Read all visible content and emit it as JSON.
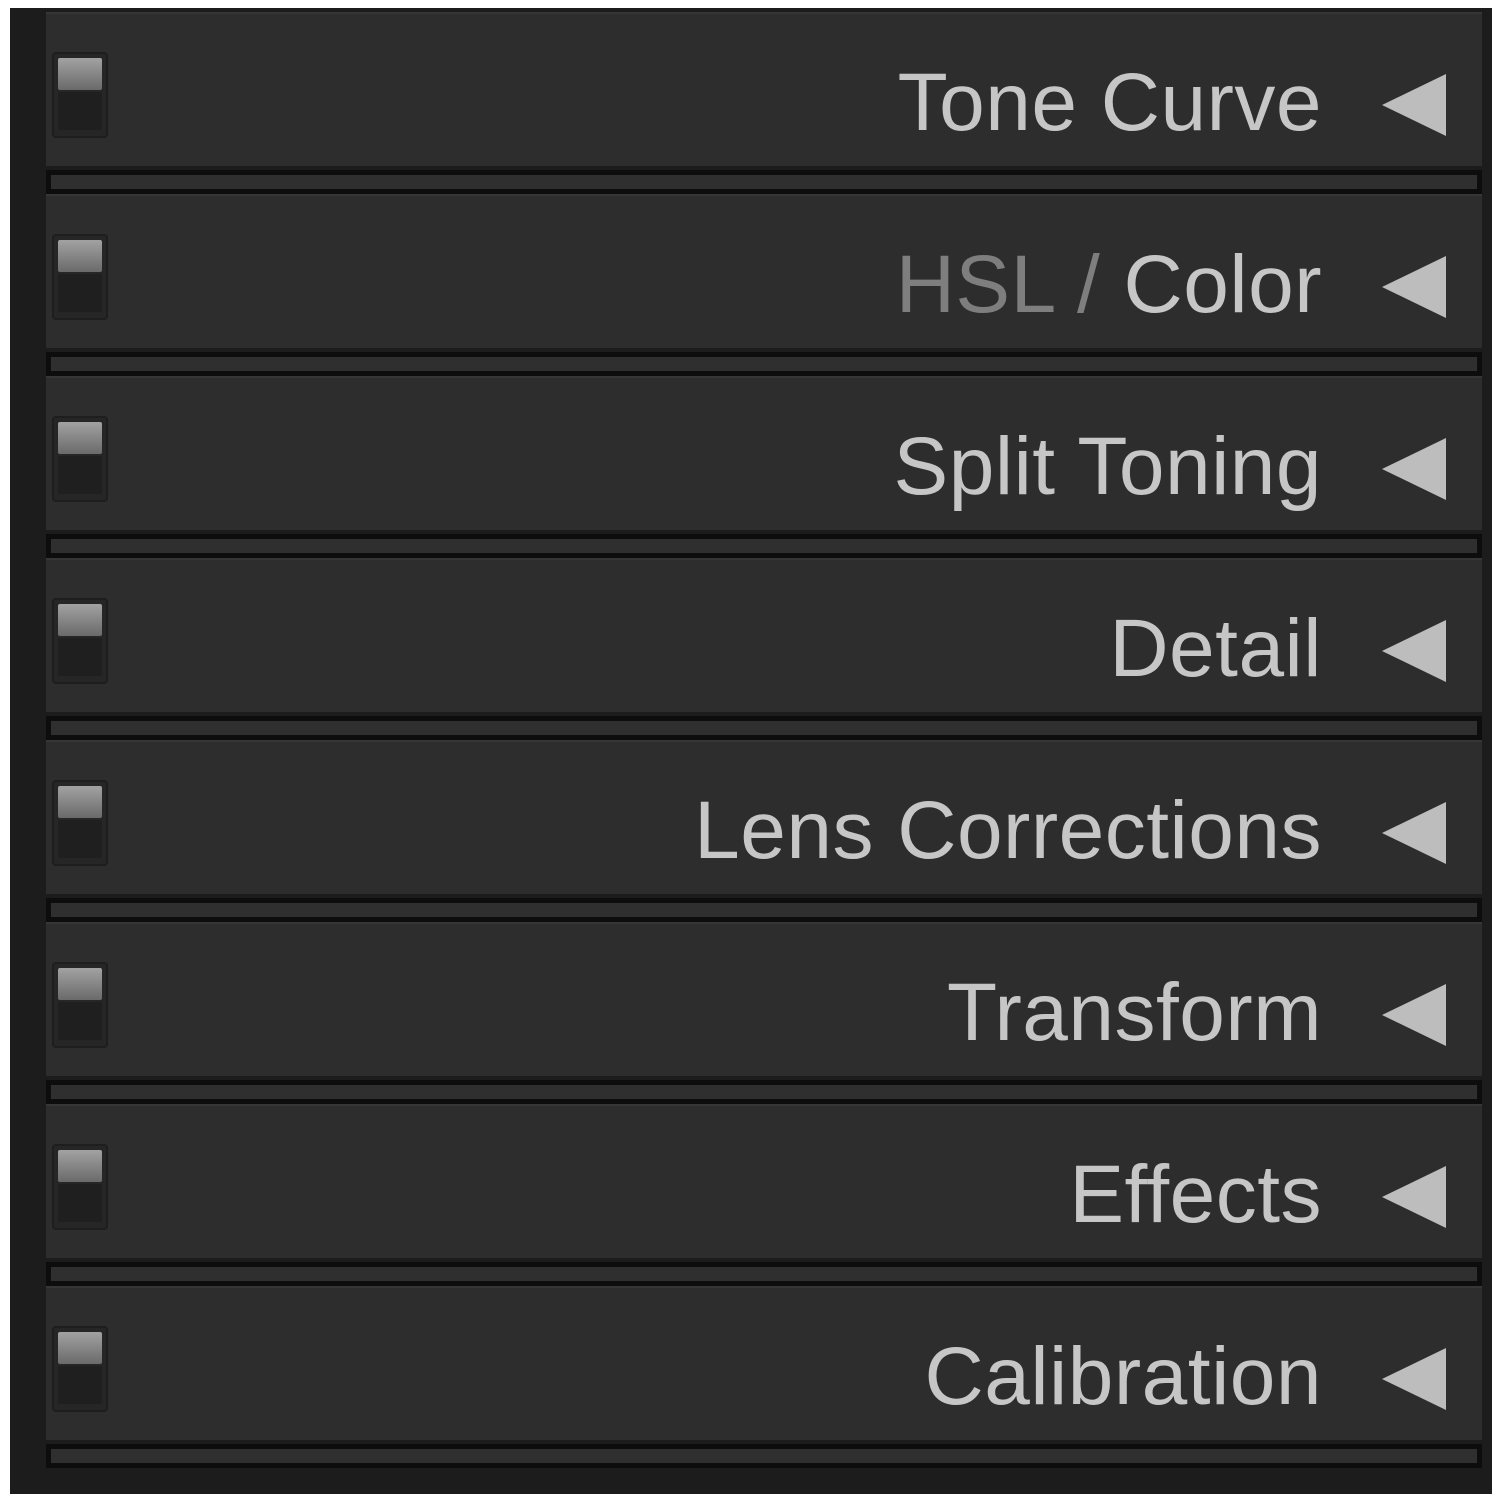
{
  "panels": [
    {
      "id": "tone-curve",
      "label": "Tone Curve"
    },
    {
      "id": "hsl-color",
      "label_prefix": "HSL /",
      "label_suffix": "Color"
    },
    {
      "id": "split-toning",
      "label": "Split Toning"
    },
    {
      "id": "detail",
      "label": "Detail"
    },
    {
      "id": "lens-corrections",
      "label": "Lens Corrections"
    },
    {
      "id": "transform",
      "label": "Transform"
    },
    {
      "id": "effects",
      "label": "Effects"
    },
    {
      "id": "calibration",
      "label": "Calibration"
    }
  ],
  "colors": {
    "panel_bg": "#2d2d2d",
    "frame": "#1c1c1c",
    "label": "#c6c6c6",
    "label_dim": "#7e7e7e",
    "arrow": "#bdbdbd"
  },
  "icons": {
    "toggle": "panel-switch-icon",
    "collapse": "collapse-arrow-icon"
  }
}
